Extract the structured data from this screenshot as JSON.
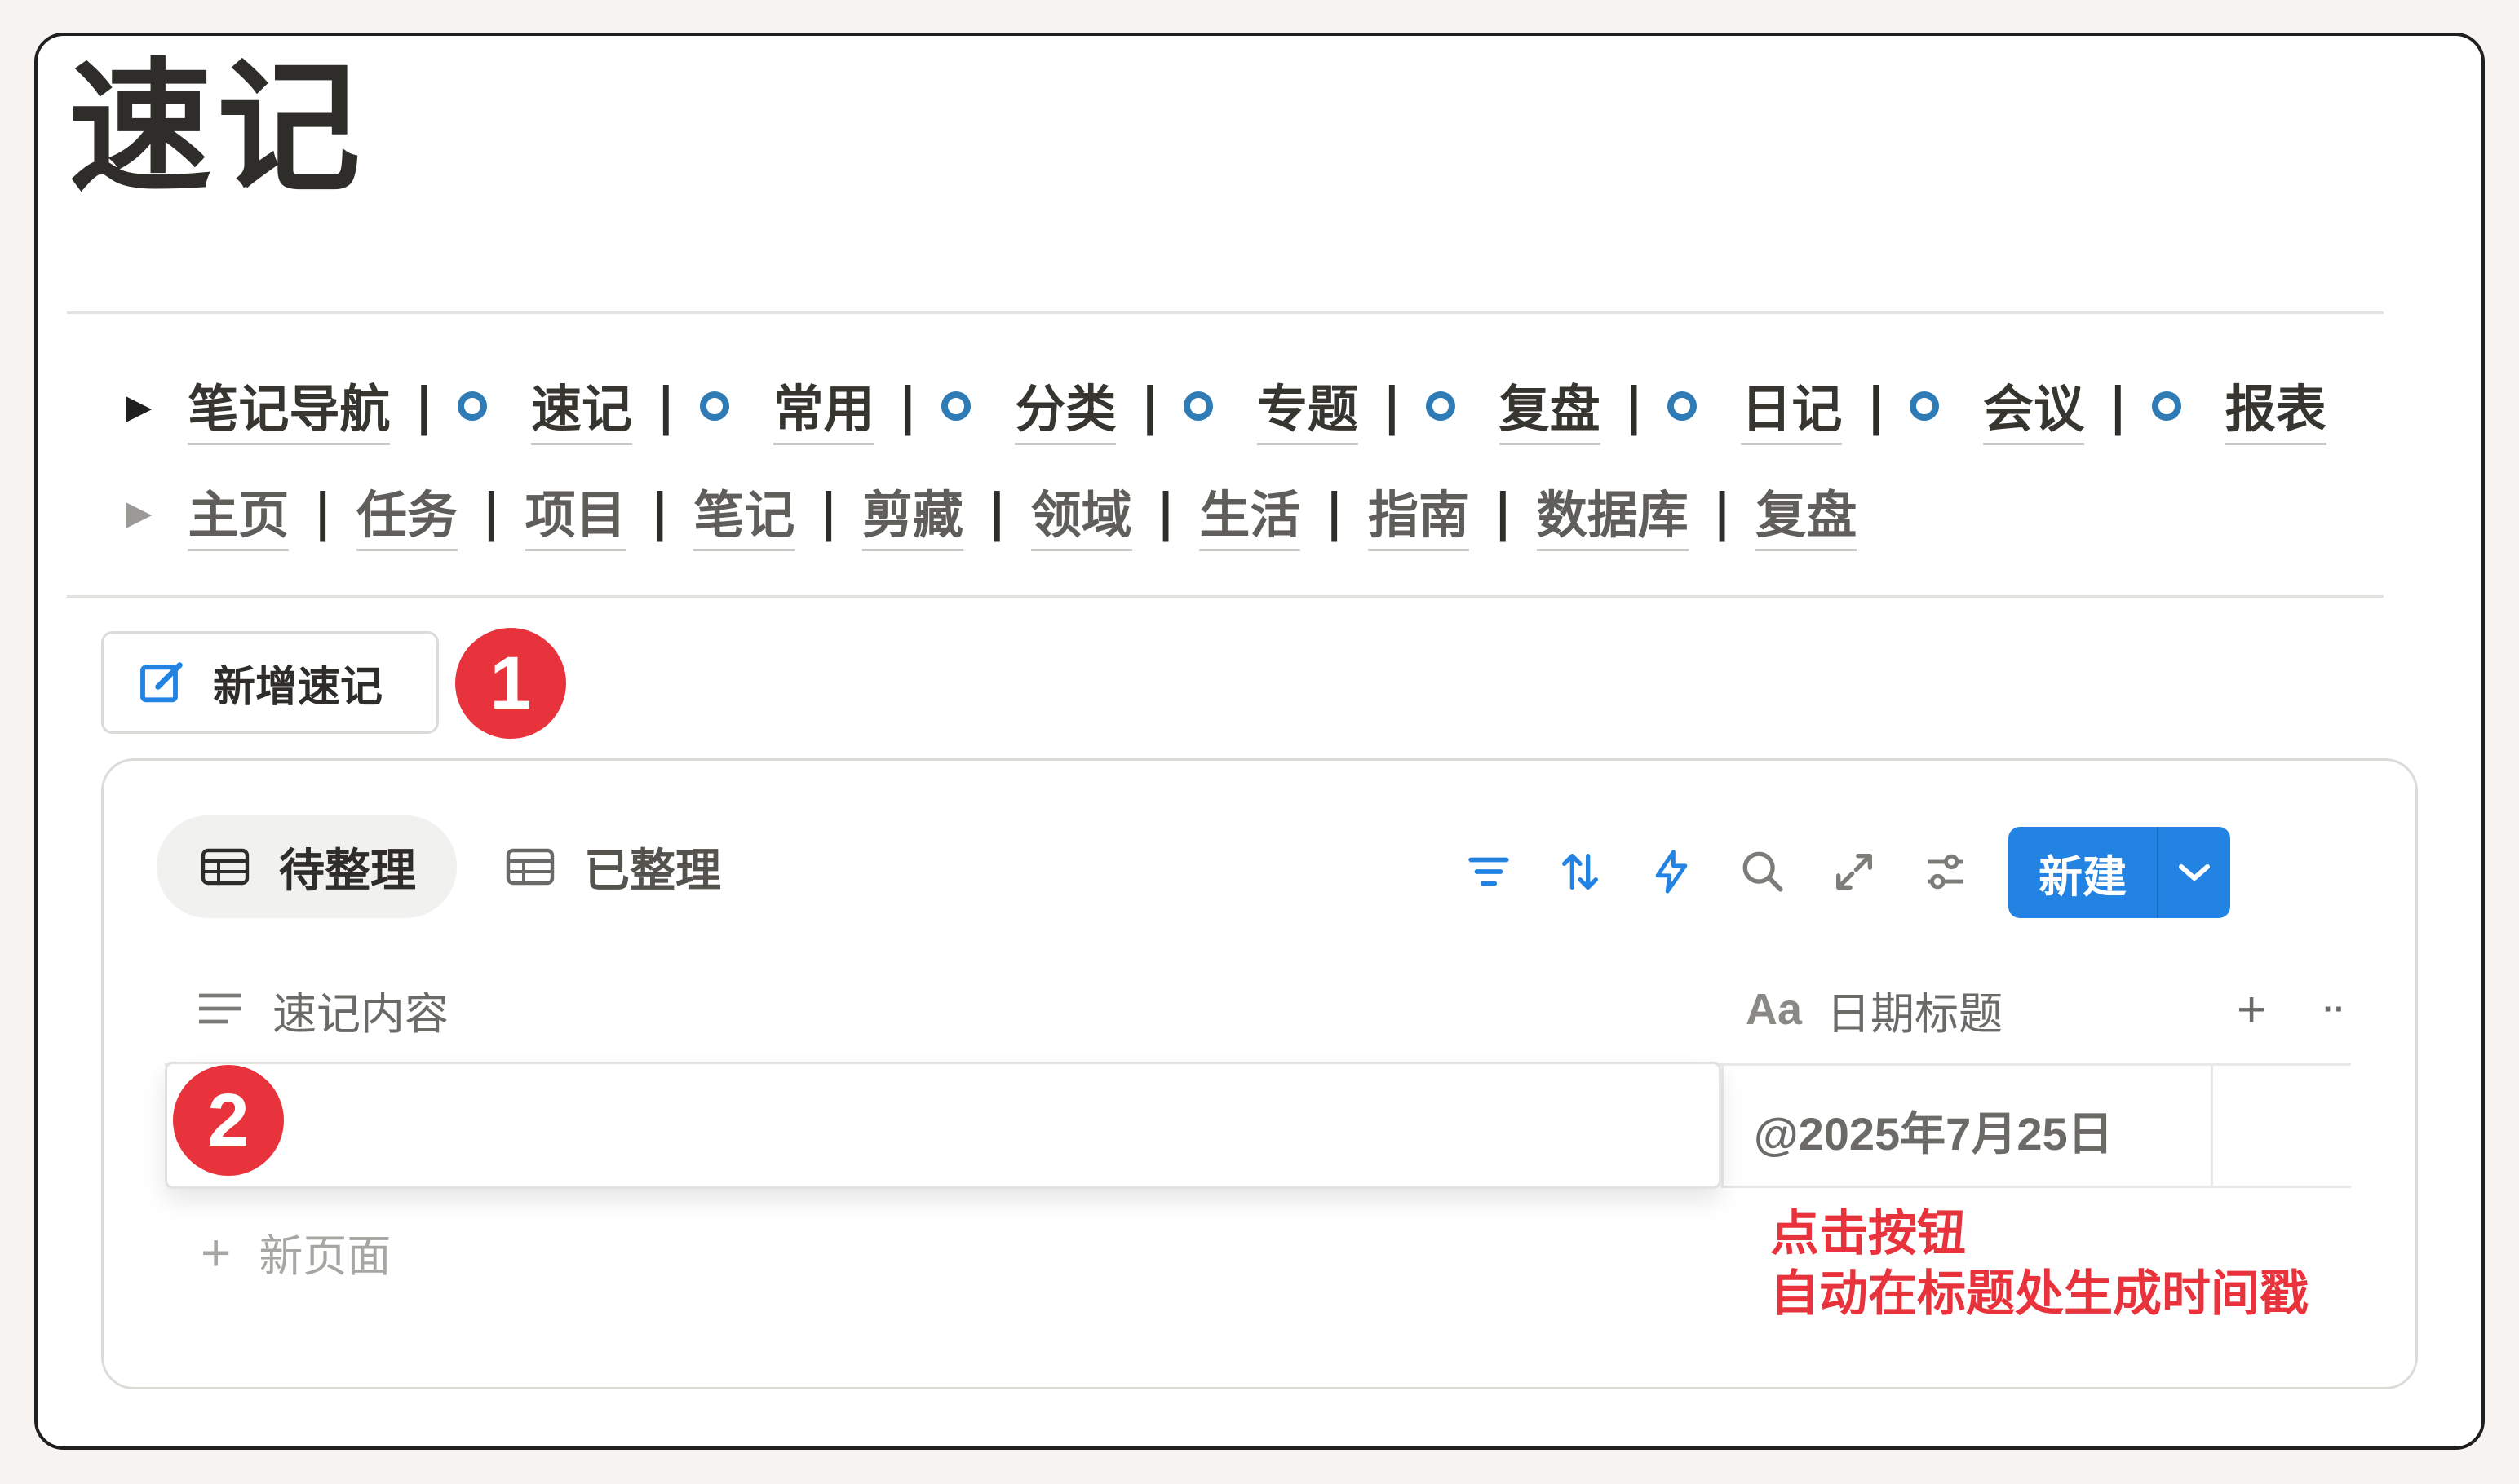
{
  "page": {
    "title": "速记"
  },
  "nav_primary": {
    "items": [
      {
        "label": "笔记导航",
        "ring": false
      },
      {
        "label": "速记",
        "ring": true
      },
      {
        "label": "常用",
        "ring": true
      },
      {
        "label": "分类",
        "ring": true
      },
      {
        "label": "专题",
        "ring": true
      },
      {
        "label": "复盘",
        "ring": true
      },
      {
        "label": "日记",
        "ring": true
      },
      {
        "label": "会议",
        "ring": true
      },
      {
        "label": "报表",
        "ring": true
      }
    ],
    "separator": "|"
  },
  "nav_secondary": {
    "items": [
      "主页",
      "任务",
      "项目",
      "笔记",
      "剪藏",
      "领域",
      "生活",
      "指南",
      "数据库",
      "复盘"
    ],
    "separator": "|"
  },
  "new_note_button": {
    "label": "新增速记",
    "icon": "edit-icon"
  },
  "badges": {
    "one": "1",
    "two": "2"
  },
  "database": {
    "tabs": [
      {
        "label": "待整理",
        "icon": "table-icon",
        "active": true
      },
      {
        "label": "已整理",
        "icon": "table-icon",
        "active": false
      }
    ],
    "toolbar_icons": [
      "filter-icon",
      "sort-icon",
      "automation-icon",
      "search-icon",
      "expand-icon",
      "settings-icon"
    ],
    "new_button": {
      "label": "新建",
      "dropdown_icon": "chevron-down-icon"
    },
    "columns": [
      {
        "label": "速记内容",
        "icon": "text-lines-icon"
      },
      {
        "label": "日期标题",
        "icon_text": "Aa"
      }
    ],
    "add_column": "+",
    "more": "··",
    "rows": [
      {
        "content": "",
        "date": "@2025年7月25日"
      }
    ],
    "new_page": {
      "plus": "+",
      "label": "新页面"
    }
  },
  "annotation": {
    "line1": "点击按钮",
    "line2": "自动在标题处生成时间戳"
  },
  "colors": {
    "accent": "#2383e2",
    "ring": "#2e7bb6",
    "badge": "#e8323c",
    "icon_blue": "#2383e2"
  }
}
